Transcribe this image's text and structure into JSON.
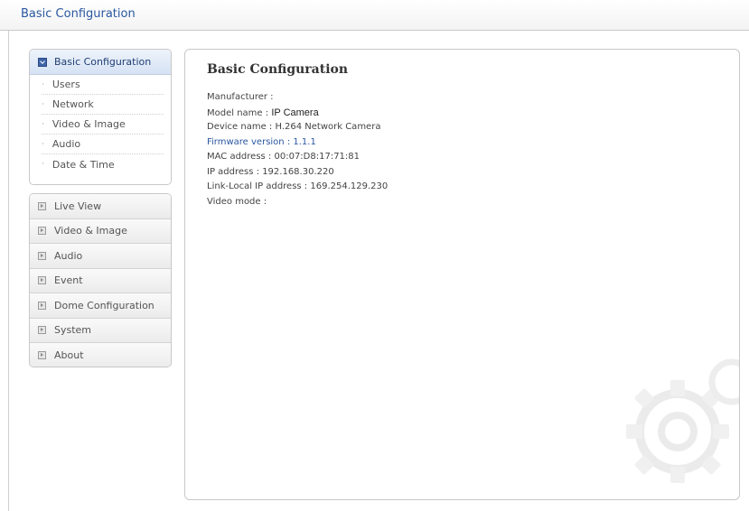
{
  "header": {
    "title": "Basic Configuration"
  },
  "sidebar": {
    "basic": {
      "label": "Basic Configuration",
      "items": [
        {
          "label": "Users"
        },
        {
          "label": "Network"
        },
        {
          "label": "Video & Image"
        },
        {
          "label": "Audio"
        },
        {
          "label": "Date & Time"
        }
      ]
    },
    "main": [
      {
        "label": "Live View"
      },
      {
        "label": "Video & Image"
      },
      {
        "label": "Audio"
      },
      {
        "label": "Event"
      },
      {
        "label": "Dome Configuration"
      },
      {
        "label": "System"
      },
      {
        "label": "About"
      }
    ]
  },
  "content": {
    "title": "Basic Configuration",
    "rows": [
      {
        "label": "Manufacturer :",
        "value": ""
      },
      {
        "label": "Model name :",
        "value": "IP Camera"
      },
      {
        "label": "Device name :",
        "value": "H.264 Network Camera"
      },
      {
        "label": "Firmware version :",
        "value": "1.1.1"
      },
      {
        "label": "MAC address :",
        "value": "00:07:D8:17:71:81"
      },
      {
        "label": "IP address :",
        "value": "192.168.30.220"
      },
      {
        "label": "Link-Local IP address :",
        "value": "169.254.129.230"
      },
      {
        "label": "Video mode :",
        "value": ""
      }
    ]
  },
  "colors": {
    "link": "#2a57a0",
    "accent": "#3f64a8"
  }
}
